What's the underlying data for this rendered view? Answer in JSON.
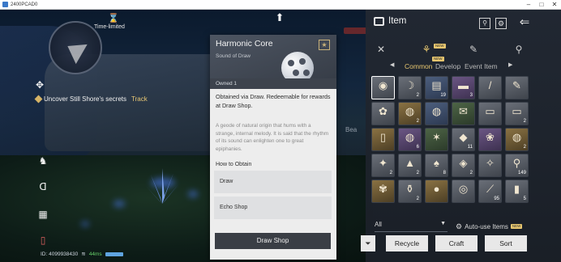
{
  "window": {
    "title": "2400PCAD0"
  },
  "hud": {
    "time_limited": "Time-limited",
    "quest_text": "Uncover Still Shore's secrets",
    "quest_track": "Track",
    "id_text": "ID: 4099938430",
    "ping": "44ms",
    "bear_label": "Bea"
  },
  "card": {
    "title": "Harmonic Core",
    "subtitle": "Sound of Draw",
    "owned": "Owned 1",
    "description": "Obtained via Draw. Redeemable for rewards at Draw Shop.",
    "flavor": "A geode of natural origin that hums with a strange, internal melody. It is said that the rhythm of its sound can enlighten one to great epiphanies.",
    "how_to_obtain": "How to Obtain",
    "sources": [
      "Draw",
      "Echo Shop"
    ],
    "button": "Draw Shop"
  },
  "panel": {
    "title": "Item",
    "new_badge": "NEW",
    "subtabs": [
      "Common",
      "Develop",
      "Event Item"
    ],
    "active_subtab": "Common",
    "filter_value": "All",
    "auto_use": "Auto-use Items",
    "buttons": {
      "recycle": "Recycle",
      "craft": "Craft",
      "sort": "Sort"
    }
  },
  "items": [
    {
      "rarity": "r-gray",
      "glyph": "◉",
      "qty": "",
      "name": "harmonic-core"
    },
    {
      "rarity": "r-gray",
      "glyph": "☽",
      "qty": "2",
      "name": "horn"
    },
    {
      "rarity": "r-blue",
      "glyph": "▤",
      "qty": "19",
      "name": "chest"
    },
    {
      "rarity": "r-purple",
      "glyph": "▬",
      "qty": "3",
      "name": "case"
    },
    {
      "rarity": "r-gray",
      "glyph": "/",
      "qty": "",
      "name": "stick"
    },
    {
      "rarity": "r-gray",
      "glyph": "✎",
      "qty": "",
      "name": "feather"
    },
    {
      "rarity": "r-gray",
      "glyph": "✿",
      "qty": "",
      "name": "flower-branch"
    },
    {
      "rarity": "r-gold",
      "glyph": "◍",
      "qty": "2",
      "name": "dish"
    },
    {
      "rarity": "r-blue",
      "glyph": "◍",
      "qty": "",
      "name": "bowl"
    },
    {
      "rarity": "r-green",
      "glyph": "✉",
      "qty": "",
      "name": "letter"
    },
    {
      "rarity": "r-gray",
      "glyph": "▭",
      "qty": "",
      "name": "card-a"
    },
    {
      "rarity": "r-gray",
      "glyph": "▭",
      "qty": "2",
      "name": "card-b"
    },
    {
      "rarity": "r-gold",
      "glyph": "▯",
      "qty": "",
      "name": "bottle"
    },
    {
      "rarity": "r-purple",
      "glyph": "◍",
      "qty": "6",
      "name": "pie"
    },
    {
      "rarity": "r-green",
      "glyph": "✶",
      "qty": "",
      "name": "herb"
    },
    {
      "rarity": "r-gray",
      "glyph": "◆",
      "qty": "11",
      "name": "ore"
    },
    {
      "rarity": "r-purple",
      "glyph": "❀",
      "qty": "",
      "name": "purple-flower"
    },
    {
      "rarity": "r-gold",
      "glyph": "◍",
      "qty": "2",
      "name": "stew"
    },
    {
      "rarity": "r-gray",
      "glyph": "✦",
      "qty": "2",
      "name": "leaf"
    },
    {
      "rarity": "r-gray",
      "glyph": "▲",
      "qty": "2",
      "name": "stone-pile"
    },
    {
      "rarity": "r-gray",
      "glyph": "♠",
      "qty": "8",
      "name": "root"
    },
    {
      "rarity": "r-gray",
      "glyph": "◈",
      "qty": "2",
      "name": "shell"
    },
    {
      "rarity": "r-gray",
      "glyph": "✧",
      "qty": "",
      "name": "bone"
    },
    {
      "rarity": "r-gray",
      "glyph": "⚲",
      "qty": "149",
      "name": "tool"
    },
    {
      "rarity": "r-gold",
      "glyph": "✾",
      "qty": "",
      "name": "meat"
    },
    {
      "rarity": "r-gray",
      "glyph": "⚱",
      "qty": "2",
      "name": "pot"
    },
    {
      "rarity": "r-gold",
      "glyph": "●",
      "qty": "",
      "name": "orb"
    },
    {
      "rarity": "r-gray",
      "glyph": "◎",
      "qty": "",
      "name": "emblem"
    },
    {
      "rarity": "r-gray",
      "glyph": "⟋",
      "qty": "95",
      "name": "arrow"
    },
    {
      "rarity": "r-gray",
      "glyph": "▮",
      "qty": "5",
      "name": "rod"
    }
  ],
  "colors": {
    "accent": "#e7c66f",
    "panel_bg": "#222832",
    "card_bg": "#ededed"
  }
}
